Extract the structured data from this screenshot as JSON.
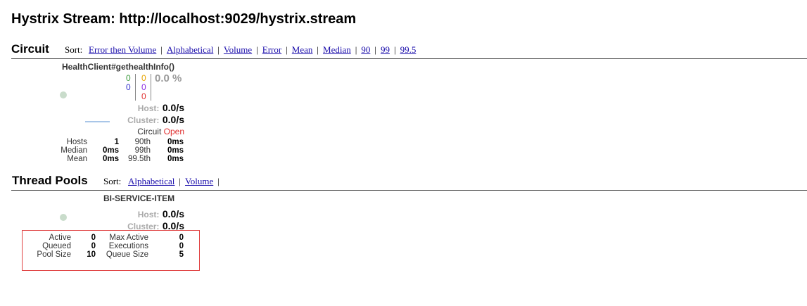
{
  "page": {
    "title": "Hystrix Stream: http://localhost:9029/hystrix.stream"
  },
  "circuit": {
    "section_title": "Circuit",
    "sort_label": "Sort:",
    "sort_links": [
      "Error then Volume",
      "Alphabetical",
      "Volume",
      "Error",
      "Mean",
      "Median",
      "90",
      "99",
      "99.5"
    ],
    "monitor": {
      "name": "HealthClient#gethealthInfo()",
      "success": "0",
      "short_circuited": "0",
      "timeout": "0",
      "rejected": "0",
      "failure": "0",
      "error_percent": "0.0 %",
      "host_label": "Host:",
      "host_rate": "0.0/s",
      "cluster_label": "Cluster:",
      "cluster_rate": "0.0/s",
      "circuit_label": "Circuit",
      "circuit_status": "Open",
      "stats": {
        "hosts_label": "Hosts",
        "hosts_value": "1",
        "median_label": "Median",
        "median_value": "0ms",
        "mean_label": "Mean",
        "mean_value": "0ms",
        "p90_label": "90th",
        "p90_value": "0ms",
        "p99_label": "99th",
        "p99_value": "0ms",
        "p995_label": "99.5th",
        "p995_value": "0ms"
      }
    }
  },
  "thread_pools": {
    "section_title": "Thread Pools",
    "sort_label": "Sort:",
    "sort_links": [
      "Alphabetical",
      "Volume"
    ],
    "monitor": {
      "name": "BI-SERVICE-ITEM",
      "host_label": "Host:",
      "host_rate": "0.0/s",
      "cluster_label": "Cluster:",
      "cluster_rate": "0.0/s",
      "stats": {
        "active_label": "Active",
        "active_value": "0",
        "queued_label": "Queued",
        "queued_value": "0",
        "pool_size_label": "Pool Size",
        "pool_size_value": "10",
        "max_active_label": "Max Active",
        "max_active_value": "0",
        "executions_label": "Executions",
        "executions_value": "0",
        "queue_size_label": "Queue Size",
        "queue_size_value": "5"
      }
    }
  },
  "colors": {
    "success": "#3c9a3c",
    "short_circuited": "#3333cc",
    "timeout": "#e6a400",
    "rejected": "#8a2be2",
    "failure": "#e03030",
    "circuit_open": "#e03030",
    "highlight_box": "#e04040"
  }
}
